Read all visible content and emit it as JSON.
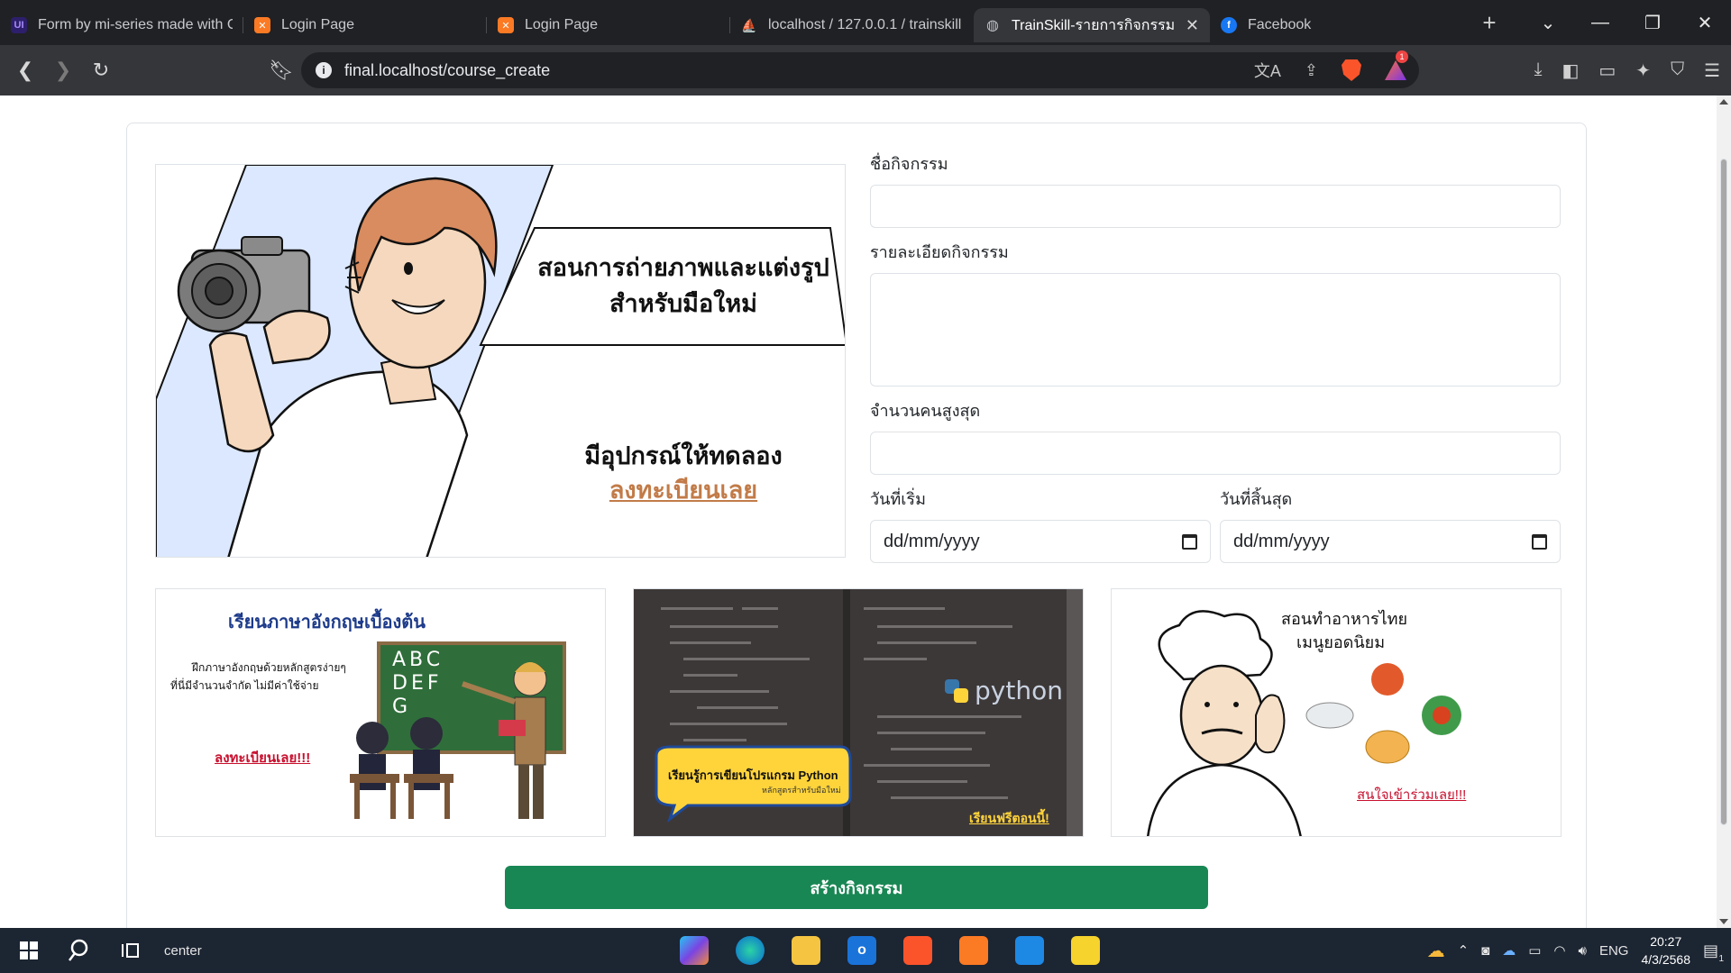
{
  "browser": {
    "tabs": [
      {
        "title": "Form by mi-series made with C",
        "favicon": "ui-icon",
        "color": "#6c5ce7"
      },
      {
        "title": "Login Page",
        "favicon": "xampp-icon",
        "color": "#fb7a24"
      },
      {
        "title": "Login Page",
        "favicon": "xampp-icon",
        "color": "#fb7a24"
      },
      {
        "title": "localhost / 127.0.0.1 / trainskill",
        "favicon": "phpmyadmin-icon",
        "color": "#f29111"
      },
      {
        "title": "TrainSkill-รายการกิจกรรม",
        "favicon": "globe-icon",
        "color": "#9aa0a6"
      },
      {
        "title": "Facebook",
        "favicon": "facebook-icon",
        "color": "#1877f2"
      }
    ],
    "active_tab_index": 4,
    "url": "final.localhost/course_create",
    "brave_badge": "1"
  },
  "hero": {
    "caption_line1": "สอนการถ่ายภาพและแต่งรูป",
    "caption_line2": "สำหรับมือใหม่",
    "caption_line3": "มีอุปกรณ์ให้ทดลอง",
    "cta": "ลงทะเบียนเลย"
  },
  "form": {
    "name_label": "ชื่อกิจกรรม",
    "name_value": "",
    "detail_label": "รายละเอียดกิจกรรม",
    "detail_value": "",
    "max_label": "จำนวนคนสูงสุด",
    "max_value": "",
    "start_label": "วันที่เริ่ม",
    "start_value": "dd/mm/yyyy",
    "end_label": "วันที่สิ้นสุด",
    "end_value": "dd/mm/yyyy",
    "submit_label": "สร้างกิจกรรม"
  },
  "thumbnails": [
    {
      "title": "เรียนภาษาอังกฤษเบื้องต้น",
      "line1": "ฝึกภาษาอังกฤษด้วยหลักสูตรง่ายๆ",
      "line2": "ที่นี่มีจำนวนจำกัด  ไม่มีค่าใช้จ่าย",
      "board_letters": "ABC\nDEF\nG",
      "cta": "ลงทะเบียนเลย!!!"
    },
    {
      "logo": "python",
      "bubble_line1": "เรียนรู้การเขียนโปรแกรม Python",
      "bubble_line2": "หลักสูตรสำหรับมือใหม่",
      "cta": "เรียนฟรีตอนนี้!"
    },
    {
      "title_line1": "สอนทำอาหารไทย",
      "title_line2": "เมนูยอดนิยม",
      "cta": "สนใจเข้าร่วมเลย!!!"
    }
  ],
  "taskbar": {
    "search_text": "center",
    "lang": "ENG",
    "time": "20:27",
    "date": "4/3/2568",
    "notification_count": "1"
  }
}
